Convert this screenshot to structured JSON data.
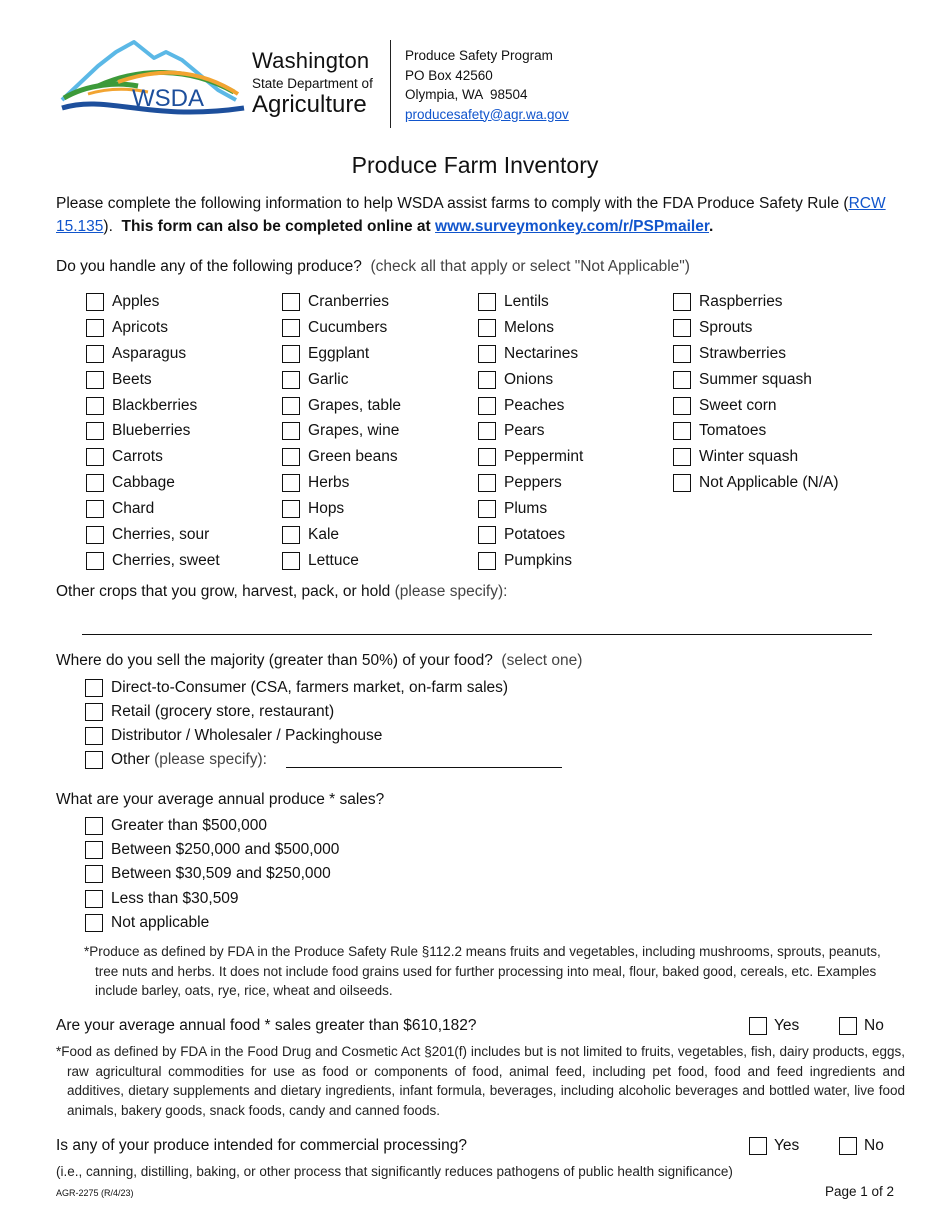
{
  "header": {
    "logo_text": "WSDA",
    "org_line1": "Washington",
    "org_line2": "State Department of",
    "org_line3": "Agriculture",
    "address": {
      "program": "Produce Safety Program",
      "po_box": "PO Box 42560",
      "city": "Olympia, WA  98504",
      "email": "producesafety@agr.wa.gov"
    }
  },
  "title": "Produce Farm Inventory",
  "intro": {
    "text1": "Please complete the following information to help WSDA assist farms to comply with the FDA Produce Safety Rule (",
    "rcw_link": "RCW 15.135",
    "text2": ").  ",
    "bold": "This form can also be completed online at ",
    "survey_link": "www.surveymonkey.com/r/PSPmailer",
    "period": "."
  },
  "produce_question": {
    "label": "Do you handle any of the following produce?",
    "hint": "  (check all that apply or select \"Not Applicable\")",
    "columns": [
      [
        "Apples",
        "Apricots",
        "Asparagus",
        "Beets",
        "Blackberries",
        "Blueberries",
        "Carrots",
        "Cabbage",
        "Chard",
        "Cherries, sour",
        "Cherries, sweet"
      ],
      [
        "Cranberries",
        "Cucumbers",
        "Eggplant",
        "Garlic",
        "Grapes, table",
        "Grapes, wine",
        "Green beans",
        "Herbs",
        "Hops",
        "Kale",
        "Lettuce"
      ],
      [
        "Lentils",
        "Melons",
        "Nectarines",
        "Onions",
        "Peaches",
        "Pears",
        "Peppermint",
        "Peppers",
        "Plums",
        "Potatoes",
        "Pumpkins"
      ],
      [
        "Raspberries",
        "Sprouts",
        "Strawberries",
        "Summer squash",
        "Sweet corn",
        "Tomatoes",
        "Winter squash",
        "Not Applicable (N/A)"
      ]
    ]
  },
  "other_crops": {
    "label": "Other crops that you grow, harvest, pack, or hold ",
    "hint": "(please specify):",
    "value": ""
  },
  "sell_question": {
    "label": "Where do you sell the majority (greater than 50%) of your food?",
    "hint": "  (select one)",
    "options": [
      "Direct-to-Consumer (CSA, farmers market, on-farm sales)",
      "Retail (grocery store, restaurant)",
      "Distributor / Wholesaler / Packinghouse"
    ],
    "other_label": "Other ",
    "other_hint": "(please specify): ",
    "other_value": ""
  },
  "sales_question": {
    "label": "What are your average annual produce * sales?",
    "options": [
      "Greater than $500,000",
      "Between $250,000 and $500,000",
      "Between $30,509 and $250,000",
      "Less than $30,509",
      "Not applicable"
    ],
    "footnote": "*Produce as defined by FDA in the Produce Safety Rule §112.2 means fruits and vegetables, including mushrooms, sprouts, peanuts, tree nuts and herbs. It does not include food grains used for further processing into meal, flour, baked good, cereals, etc.  Examples include barley, oats, rye, rice, wheat and oilseeds."
  },
  "food_question": {
    "label": "Are your average annual food * sales greater than $610,182?",
    "yes": "Yes",
    "no": "No",
    "footnote": "*Food as defined by FDA in the Food Drug and Cosmetic Act §201(f) includes but is not limited to fruits, vegetables, fish, dairy products, eggs, raw agricultural commodities for use as food or components of food, animal feed, including pet food, food and feed ingredients and additives, dietary supplements and dietary ingredients, infant formula, beverages, including alcoholic beverages and bottled water, live food animals, bakery goods, snack foods, candy and canned foods."
  },
  "processing_question": {
    "label": "Is any of your produce intended for commercial processing?",
    "yes": "Yes",
    "no": "No",
    "note": "(i.e., canning, distilling, baking, or other process that significantly reduces pathogens of public health significance)"
  },
  "footer": {
    "form_id": "AGR-2275 (R/4/23)",
    "page": "Page 1 of 2"
  },
  "colors": {
    "link": "#1155cc",
    "logo_sky": "#5bb8e6",
    "logo_green": "#3d9a3a",
    "logo_orange": "#f2a431",
    "logo_blue": "#1d4f9c"
  }
}
